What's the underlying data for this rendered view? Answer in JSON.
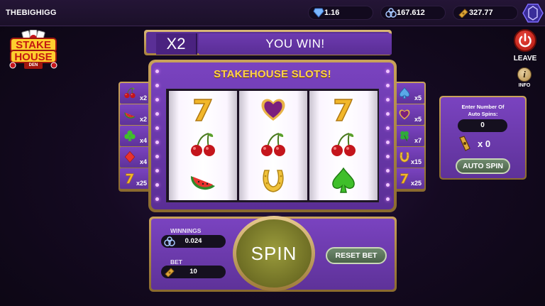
{
  "topbar": {
    "username": "THEBIGHIGG",
    "balances": [
      {
        "icon": "diamond-gem-icon",
        "value": "1.16"
      },
      {
        "icon": "crypto-coin-icon",
        "value": "167.612"
      },
      {
        "icon": "ticket-icon",
        "value": "327.77"
      }
    ]
  },
  "logo": {
    "line1": "STAKE",
    "line2": "HOUSE",
    "line3": "DEN"
  },
  "sidebar_right": {
    "leave_label": "LEAVE",
    "info_label": "INFO"
  },
  "banner": {
    "multiplier": "X2",
    "message": "YOU WIN!"
  },
  "machine": {
    "title": "STAKEHOUSE SLOTS!",
    "reels": [
      [
        "seven",
        "cherries",
        "watermelon"
      ],
      [
        "heart",
        "cherries",
        "horseshoe"
      ],
      [
        "seven",
        "cherries",
        "spade"
      ]
    ]
  },
  "paytable_left": [
    {
      "symbol": "cherries",
      "multiplier": "x2"
    },
    {
      "symbol": "watermelon",
      "multiplier": "x2"
    },
    {
      "symbol": "club",
      "multiplier": "x4"
    },
    {
      "symbol": "diamond",
      "multiplier": "x4"
    },
    {
      "symbol": "seven",
      "multiplier": "x25"
    }
  ],
  "paytable_right": [
    {
      "symbol": "spade-blue",
      "multiplier": "x5"
    },
    {
      "symbol": "heart",
      "multiplier": "x5"
    },
    {
      "symbol": "clover",
      "multiplier": "x7"
    },
    {
      "symbol": "horseshoe",
      "multiplier": "x15"
    },
    {
      "symbol": "seven",
      "multiplier": "x25"
    }
  ],
  "auto_spin": {
    "label_line1": "Enter Number Of",
    "label_line2": "Auto Spins:",
    "value": "0",
    "count": "x 0",
    "button": "AUTO SPIN"
  },
  "controls": {
    "winnings_label": "WINNINGS",
    "winnings_value": "0.024",
    "bet_label": "BET",
    "bet_value": "10",
    "spin_label": "SPIN",
    "reset_label": "RESET BET"
  },
  "colors": {
    "panel_purple": "#6f3db3",
    "gold_frame": "#c9a25a",
    "title_yellow": "#ffd24a",
    "spin_olive": "#7f8030",
    "leave_red": "#d42e22"
  }
}
